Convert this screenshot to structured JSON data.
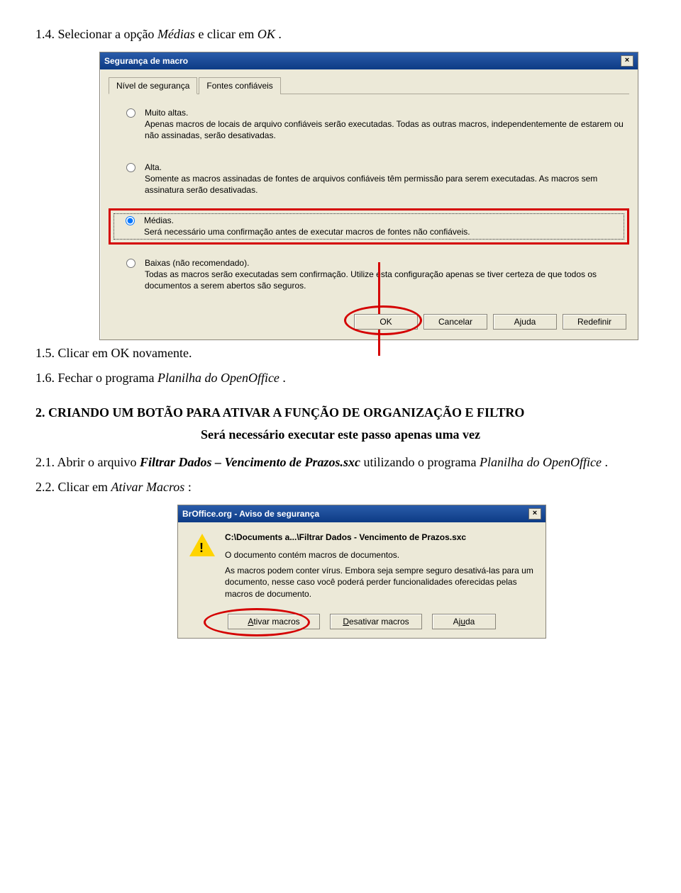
{
  "step1_4": {
    "num": "1.4. ",
    "text1": "Selecionar a opção ",
    "italic1": "Médias",
    "text2": " e clicar em ",
    "italic2": "OK",
    "text3": "."
  },
  "dialog1": {
    "title": "Segurança de macro",
    "tabs": {
      "t1": "Nível de segurança",
      "t2": "Fontes confiáveis"
    },
    "opt1": {
      "title": "Muito altas.",
      "desc": "Apenas macros de locais de arquivo confiáveis serão executadas. Todas as outras macros, independentemente de estarem ou não assinadas, serão desativadas."
    },
    "opt2": {
      "title": "Alta.",
      "desc": "Somente as macros assinadas de fontes de arquivos confiáveis têm permissão para serem executadas. As macros sem assinatura serão desativadas."
    },
    "opt3": {
      "title": "Médias.",
      "desc": "Será necessário uma confirmação antes de executar macros de fontes não confiáveis."
    },
    "opt4": {
      "title": "Baixas (não recomendado).",
      "desc": "Todas as macros serão executadas sem confirmação. Utilize esta configuração apenas se tiver certeza de que todos os documentos a serem abertos são seguros."
    },
    "buttons": {
      "ok": "OK",
      "cancel": "Cancelar",
      "help": "Ajuda",
      "reset": "Redefinir"
    }
  },
  "step1_5": {
    "num": "1.5. ",
    "text": "Clicar em OK novamente."
  },
  "step1_6": {
    "num": "1.6. ",
    "text1": "Fechar o programa ",
    "italic": "Planilha do OpenOffice",
    "text2": "."
  },
  "section2": {
    "title": "2. CRIANDO UM BOTÃO PARA ATIVAR A FUNÇÃO DE ORGANIZAÇÃO E FILTRO",
    "subtitle": "Será necessário executar este passo apenas uma vez"
  },
  "step2_1": {
    "num": "2.1. ",
    "text1": "Abrir o arquivo ",
    "italic1": "Filtrar Dados – Vencimento de Prazos.sxc",
    "text2": " utilizando o programa ",
    "italic2": "Planilha do OpenOffice",
    "text3": "."
  },
  "step2_2": {
    "num": "2.2. ",
    "text1": "Clicar em ",
    "italic": "Ativar Macros",
    "text2": ":"
  },
  "dialog2": {
    "title": "BrOffice.org - Aviso de segurança",
    "filepath": "C:\\Documents a...\\Filtrar Dados - Vencimento de Prazos.sxc",
    "para1": "O documento contém macros de documentos.",
    "para2": "As macros podem conter vírus. Embora seja sempre seguro desativá-las para um documento, nesse caso você poderá perder funcionalidades oferecidas pelas macros de documento.",
    "buttons": {
      "enable": "Ativar macros",
      "disable": "Desativar macros",
      "help": "Ajuda"
    }
  }
}
